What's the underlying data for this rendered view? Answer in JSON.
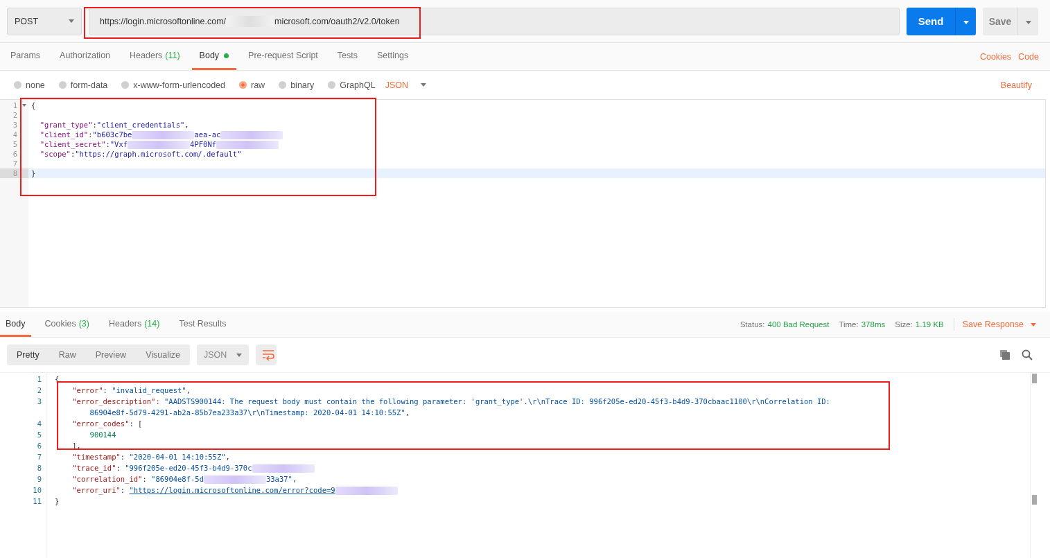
{
  "request": {
    "method": "POST",
    "url": {
      "parts": [
        {
          "kind": "text",
          "text": "https://login.microsoftonline.com/"
        },
        {
          "kind": "redacted"
        },
        {
          "kind": "text",
          "text": "microsoft.com/oauth2/v2.0/token"
        }
      ]
    },
    "send": "Send",
    "save": "Save"
  },
  "request_tabs": [
    {
      "label": "Params",
      "selected": false
    },
    {
      "label": "Authorization",
      "selected": false
    },
    {
      "label": "Headers",
      "count": "(11)",
      "selected": false
    },
    {
      "label": "Body",
      "dot": true,
      "selected": true
    },
    {
      "label": "Pre-request Script",
      "selected": false
    },
    {
      "label": "Tests",
      "selected": false
    },
    {
      "label": "Settings",
      "selected": false
    }
  ],
  "request_links": [
    "Cookies",
    "Code"
  ],
  "body_types": [
    {
      "label": "none",
      "selected": false
    },
    {
      "label": "form-data",
      "selected": false
    },
    {
      "label": "x-www-form-urlencoded",
      "selected": false
    },
    {
      "label": "raw",
      "selected": true
    },
    {
      "label": "binary",
      "selected": false
    },
    {
      "label": "GraphQL",
      "selected": false
    }
  ],
  "format": "JSON",
  "beautify": "Beautify",
  "request_body": [
    {
      "number": "1",
      "fold": true,
      "active": false,
      "rows": [
        [
          {
            "kind": "punct",
            "text": "{"
          }
        ]
      ]
    },
    {
      "number": "2",
      "fold": false,
      "active": false,
      "rows": [
        []
      ]
    },
    {
      "number": "3",
      "fold": false,
      "active": false,
      "rows": [
        [
          {
            "kind": "key",
            "text": "  \"grant_type\""
          },
          {
            "kind": "punct",
            "text": ":"
          },
          {
            "kind": "string",
            "text": "\"client_credentials\""
          },
          {
            "kind": "punct",
            "text": ","
          }
        ]
      ]
    },
    {
      "number": "4",
      "fold": false,
      "active": false,
      "rows": [
        [
          {
            "kind": "key",
            "text": "  \"client_id\""
          },
          {
            "kind": "punct",
            "text": ":"
          },
          {
            "kind": "string",
            "text": "\"b603c7be"
          },
          {
            "kind": "redacted"
          },
          {
            "kind": "string",
            "text": "aea-ac"
          },
          {
            "kind": "redacted"
          }
        ]
      ]
    },
    {
      "number": "5",
      "fold": false,
      "active": false,
      "rows": [
        [
          {
            "kind": "key",
            "text": "  \"client_secret\""
          },
          {
            "kind": "punct",
            "text": ":"
          },
          {
            "kind": "string",
            "text": "\"Vxf"
          },
          {
            "kind": "redacted"
          },
          {
            "kind": "string",
            "text": "4PF0Nf"
          },
          {
            "kind": "redacted"
          }
        ]
      ]
    },
    {
      "number": "6",
      "fold": false,
      "active": false,
      "rows": [
        [
          {
            "kind": "key",
            "text": "  \"scope\""
          },
          {
            "kind": "punct",
            "text": ":"
          },
          {
            "kind": "string",
            "text": "\"https://graph.microsoft.com/.default\""
          }
        ]
      ]
    },
    {
      "number": "7",
      "fold": false,
      "active": false,
      "rows": [
        []
      ]
    },
    {
      "number": "8",
      "fold": false,
      "active": true,
      "rows": [
        [
          {
            "kind": "punct",
            "text": "}"
          }
        ]
      ]
    }
  ],
  "response_tabs": [
    {
      "label": "Body",
      "selected": true
    },
    {
      "label": "Cookies",
      "count": "(3)",
      "selected": false
    },
    {
      "label": "Headers",
      "count": "(14)",
      "selected": false
    },
    {
      "label": "Test Results",
      "selected": false
    }
  ],
  "response_meta": [
    {
      "label": "Status:",
      "value": "400 Bad Request"
    },
    {
      "label": "Time:",
      "value": "378ms"
    },
    {
      "label": "Size:",
      "value": "1.19 KB"
    }
  ],
  "save_response": "Save Response",
  "view_modes": [
    {
      "label": "Pretty",
      "selected": true
    },
    {
      "label": "Raw",
      "selected": false
    },
    {
      "label": "Preview",
      "selected": false
    },
    {
      "label": "Visualize",
      "selected": false
    }
  ],
  "response_format": "JSON",
  "response_body": [
    {
      "number": "1",
      "rows": [
        [
          {
            "kind": "punct",
            "text": "{"
          }
        ]
      ]
    },
    {
      "number": "2",
      "rows": [
        [
          {
            "kind": "key",
            "text": "    \"error\""
          },
          {
            "kind": "punct",
            "text": ": "
          },
          {
            "kind": "string",
            "text": "\"invalid_request\""
          },
          {
            "kind": "punct",
            "text": ","
          }
        ]
      ]
    },
    {
      "number": "3",
      "rows": [
        [
          {
            "kind": "key",
            "text": "    \"error_description\": "
          },
          {
            "kind": "string",
            "text": "\"AADSTS900144: The request body must contain the following parameter: 'grant_type'.\\r\\nTrace ID: 996f205e-ed20-45f3-b4d9-370cbaac1100\\r\\nCorrelation ID:"
          }
        ],
        [
          {
            "kind": "string",
            "text": "        86904e8f-5d79-4291-ab2a-85b7ea233a37\\r\\nTimestamp: 2020-04-01 14:10:55Z\""
          },
          {
            "kind": "punct",
            "text": ","
          }
        ]
      ]
    },
    {
      "number": "4",
      "rows": [
        [
          {
            "kind": "key",
            "text": "    \"error_codes\""
          },
          {
            "kind": "punct",
            "text": ": ["
          }
        ]
      ]
    },
    {
      "number": "5",
      "rows": [
        [
          {
            "kind": "number",
            "text": "        900144"
          }
        ]
      ]
    },
    {
      "number": "6",
      "rows": [
        [
          {
            "kind": "punct",
            "text": "    ],"
          }
        ]
      ]
    },
    {
      "number": "7",
      "rows": [
        [
          {
            "kind": "key",
            "text": "    \"timestamp\""
          },
          {
            "kind": "punct",
            "text": ": "
          },
          {
            "kind": "string",
            "text": "\"2020-04-01 14:10:55Z\""
          },
          {
            "kind": "punct",
            "text": ","
          }
        ]
      ]
    },
    {
      "number": "8",
      "rows": [
        [
          {
            "kind": "key",
            "text": "    \"trace_id\""
          },
          {
            "kind": "punct",
            "text": ": "
          },
          {
            "kind": "string",
            "text": "\"996f205e-ed20-45f3-b4d9-370c"
          },
          {
            "kind": "redacted"
          }
        ]
      ]
    },
    {
      "number": "9",
      "rows": [
        [
          {
            "kind": "key",
            "text": "    \"correlation_id\""
          },
          {
            "kind": "punct",
            "text": ": "
          },
          {
            "kind": "string",
            "text": "\"86904e8f-5d"
          },
          {
            "kind": "redacted"
          },
          {
            "kind": "string",
            "text": "33a37\""
          },
          {
            "kind": "punct",
            "text": ","
          }
        ]
      ]
    },
    {
      "number": "10",
      "rows": [
        [
          {
            "kind": "key",
            "text": "    \"error_uri\""
          },
          {
            "kind": "punct",
            "text": ": "
          },
          {
            "kind": "link",
            "text": "\"https://login.microsoftonline.com/error?code=9"
          },
          {
            "kind": "redacted"
          }
        ]
      ]
    },
    {
      "number": "11",
      "rows": [
        [
          {
            "kind": "punct",
            "text": "}"
          }
        ]
      ]
    }
  ]
}
